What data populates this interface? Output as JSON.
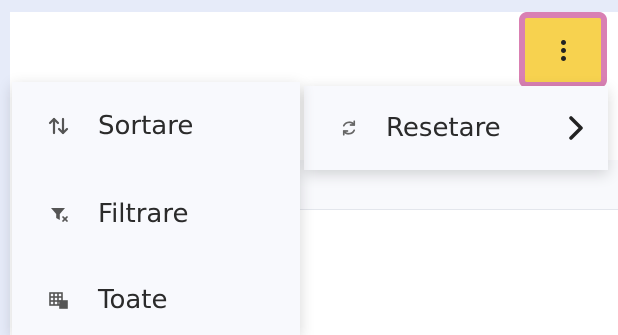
{
  "menu": {
    "items": [
      {
        "label": "Sortare",
        "icon": "sort-icon"
      },
      {
        "label": "Filtrare",
        "icon": "filter-icon"
      },
      {
        "label": "Toate",
        "icon": "grid-settings-icon"
      }
    ]
  },
  "submenu": {
    "label": "Resetare",
    "icon": "reset-icon",
    "chevron": "chevron-right-icon"
  },
  "toolbar": {
    "more_icon": "more-vertical-icon"
  },
  "colors": {
    "highlight": "#f7d24f",
    "highlight_border": "#d980b3",
    "menu_bg": "#f8f9fd",
    "page_bg": "#e6ebf9"
  }
}
